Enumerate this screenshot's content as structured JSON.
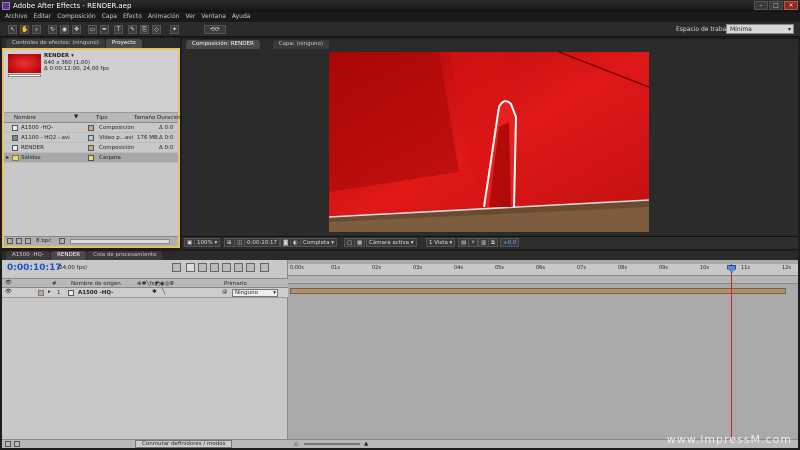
{
  "app": {
    "title": "Adobe After Effects - RENDER.aep",
    "window_controls": [
      "–",
      "□",
      "✕"
    ]
  },
  "menu": [
    "Archivo",
    "Editar",
    "Composición",
    "Capa",
    "Efecto",
    "Animación",
    "Ver",
    "Ventana",
    "Ayuda"
  ],
  "toolbar": {
    "tools": [
      "arrow-tool",
      "hand-tool",
      "zoom-tool",
      "rotate-tool",
      "camera-tool",
      "pan-behind-tool",
      "rectangle-tool",
      "pen-tool",
      "text-tool",
      "brush-tool",
      "clone-tool",
      "eraser-tool",
      "puppet-tool"
    ],
    "workspace_label": "Espacio de trabajo:",
    "workspace_value": "Mínima"
  },
  "project": {
    "tabs": [
      "Controles de efectos: (ninguno)",
      "Proyecto"
    ],
    "selected_name": "RENDER ▾",
    "selected_info1": "640 x 360 (1,00)",
    "selected_info2": "Δ 0:00:12:00, 24,00 fps",
    "columns": {
      "name": "Nombre",
      "type": "Tipo",
      "size": "Tamaño",
      "duration": "Duración"
    },
    "items": [
      {
        "name": "A1500 -HQ-",
        "type": "Composición",
        "size": "",
        "duration": "Δ 0:0",
        "label_color": "#c8a888"
      },
      {
        "name": "A1100 - HQ2 -.avi",
        "type": "Vídeo p...avi",
        "size": "176 MB",
        "duration": "Δ 0:0",
        "label_color": "#a8c8d8"
      },
      {
        "name": "RENDER",
        "type": "Composición",
        "size": "",
        "duration": "Δ 0:0",
        "label_color": "#c8a888"
      },
      {
        "name": "Sólidos",
        "type": "Carpeta",
        "size": "",
        "duration": "",
        "label_color": "#e8d870"
      }
    ],
    "bpc": "8 bpc"
  },
  "composition": {
    "tabs": [
      "Composición: RENDER",
      "Capa: (ninguno)"
    ],
    "zoom": "100%",
    "timecode": "0:00:10:17",
    "resolution": "Completa",
    "camera": "Cámara activa",
    "views": "1 Vista",
    "exposure": "+0,0"
  },
  "timeline": {
    "tabs": [
      "A1500 -HQ-",
      "RENDER",
      "Cola de procesamiento"
    ],
    "timecode": "0:00:10:17",
    "fps": "(24,00 fps)",
    "col_name": "Nombre de origen",
    "col_parent": "Primario",
    "layer_index": "1",
    "layer_name": "A1500 -HQ-",
    "parent_value": "Ninguno",
    "ruler": [
      "0:00s",
      "01s",
      "02s",
      "03s",
      "04s",
      "05s",
      "06s",
      "07s",
      "08s",
      "09s",
      "10s",
      "11s",
      "12s"
    ],
    "current_time_seconds": 10.71,
    "duration_seconds": 12,
    "toggle_label": "Conmutar definidores / modos"
  },
  "watermark": "www.impressM.com",
  "colors": {
    "accent_timecode": "#1a55c8",
    "cti": "#d02020",
    "highlight": "#e8c55a"
  }
}
